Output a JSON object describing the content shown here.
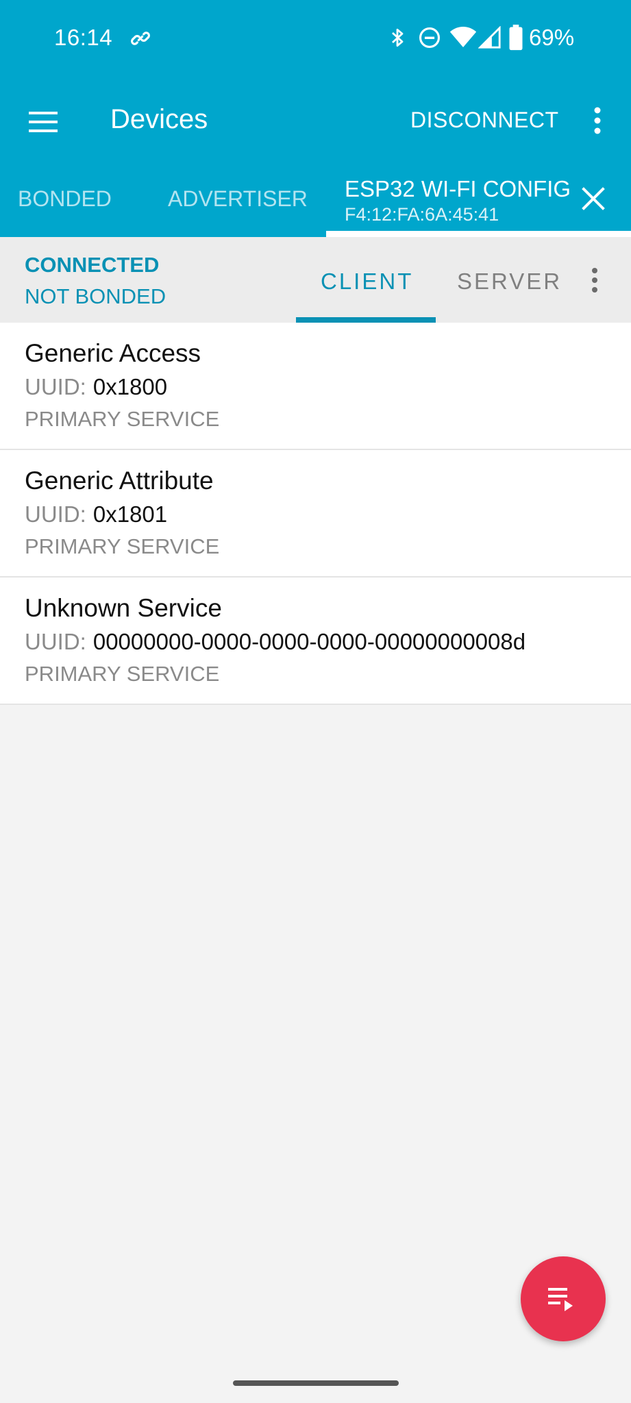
{
  "status_bar": {
    "time": "16:14",
    "battery": "69%",
    "icons": [
      "link-icon",
      "bluetooth-icon",
      "dnd-icon",
      "wifi-icon",
      "signal-icon",
      "battery-icon"
    ]
  },
  "toolbar": {
    "title": "Devices",
    "disconnect_label": "DISCONNECT"
  },
  "tabs": [
    {
      "label": "BONDED"
    },
    {
      "label": "ADVERTISER"
    },
    {
      "label": "ESP32 WI-FI CONFIG",
      "address": "F4:12:FA:6A:45:41",
      "active": true
    }
  ],
  "connection": {
    "state": "CONNECTED",
    "bond_state": "NOT BONDED"
  },
  "subtabs": [
    {
      "label": "CLIENT",
      "active": true
    },
    {
      "label": "SERVER",
      "active": false
    }
  ],
  "services": [
    {
      "name": "Generic Access",
      "uuid_label": "UUID:",
      "uuid": "0x1800",
      "type": "PRIMARY SERVICE"
    },
    {
      "name": "Generic Attribute",
      "uuid_label": "UUID:",
      "uuid": "0x1801",
      "type": "PRIMARY SERVICE"
    },
    {
      "name": "Unknown Service",
      "uuid_label": "UUID:",
      "uuid": "00000000-0000-0000-0000-00000000008d",
      "type": "PRIMARY SERVICE"
    }
  ],
  "colors": {
    "primary": "#00a6cc",
    "accent": "#0a91b4",
    "fab": "#e8324f"
  }
}
